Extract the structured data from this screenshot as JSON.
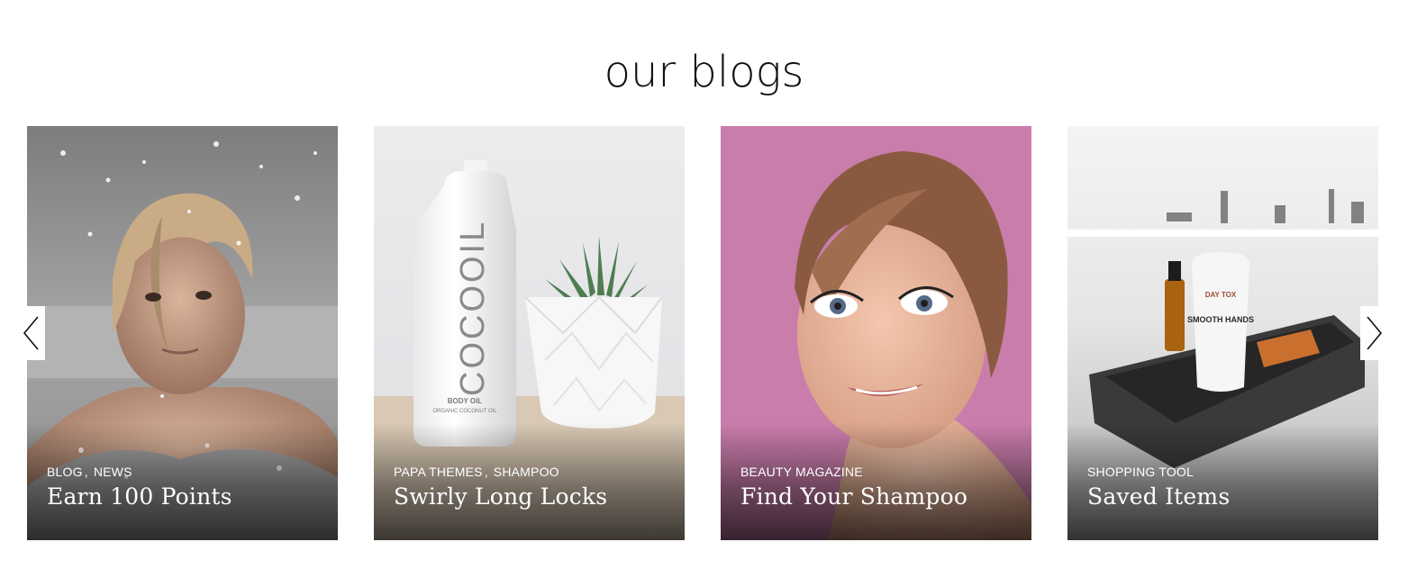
{
  "section": {
    "title": "our blogs"
  },
  "posts": [
    {
      "categories": [
        "BLOG",
        "NEWS"
      ],
      "title": "Earn 100 Points"
    },
    {
      "categories": [
        "PAPA THEMES",
        "SHAMPOO"
      ],
      "title": "Swirly Long Locks"
    },
    {
      "categories": [
        "BEAUTY MAGAZINE"
      ],
      "title": "Find Your Shampoo"
    },
    {
      "categories": [
        "SHOPPING TOOL"
      ],
      "title": "Saved Items"
    }
  ],
  "product_labels": {
    "bottle_brand": "COCOOIL",
    "bottle_line1": "BODY OIL",
    "bottle_line2": "ORGANIC COCONUT OIL",
    "tube_brand": "DAY TOX",
    "tube_text": "SMOOTH HANDS"
  },
  "icons": {
    "prev": "chevron-left-icon",
    "next": "chevron-right-icon"
  }
}
